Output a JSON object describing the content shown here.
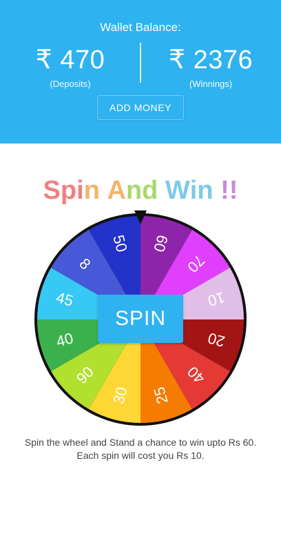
{
  "header": {
    "title": "Wallet Balance:",
    "deposits": {
      "amount": "₹ 470",
      "label": "(Deposits)"
    },
    "winnings": {
      "amount": "₹ 2376",
      "label": "(Winnings)"
    },
    "add_money_label": "ADD MONEY"
  },
  "game": {
    "title": "Spin And Win !!",
    "title_colors": [
      "#f08080",
      "#f2b56b",
      "#a8d86e",
      "#7dc9e8",
      "#c88ad8"
    ],
    "spin_label": "SPIN",
    "wheel_segments": [
      {
        "label": "60",
        "color": "#8e24aa"
      },
      {
        "label": "70",
        "color": "#e040fb"
      },
      {
        "label": "10",
        "color": "#e1bee7"
      },
      {
        "label": "20",
        "color": "#a31515"
      },
      {
        "label": "40",
        "color": "#e53935"
      },
      {
        "label": "25",
        "color": "#f57c00"
      },
      {
        "label": "30",
        "color": "#fdd835"
      },
      {
        "label": "90",
        "color": "#b2e02f"
      },
      {
        "label": "40",
        "color": "#3cb04c"
      },
      {
        "label": "45",
        "color": "#37c8f4"
      },
      {
        "label": "8",
        "color": "#4758d8"
      },
      {
        "label": "50",
        "color": "#2332c8"
      }
    ],
    "info_line1": "Spin the wheel and Stand a chance to win upto Rs 60.",
    "info_line2": "Each spin will cost you Rs 10."
  }
}
